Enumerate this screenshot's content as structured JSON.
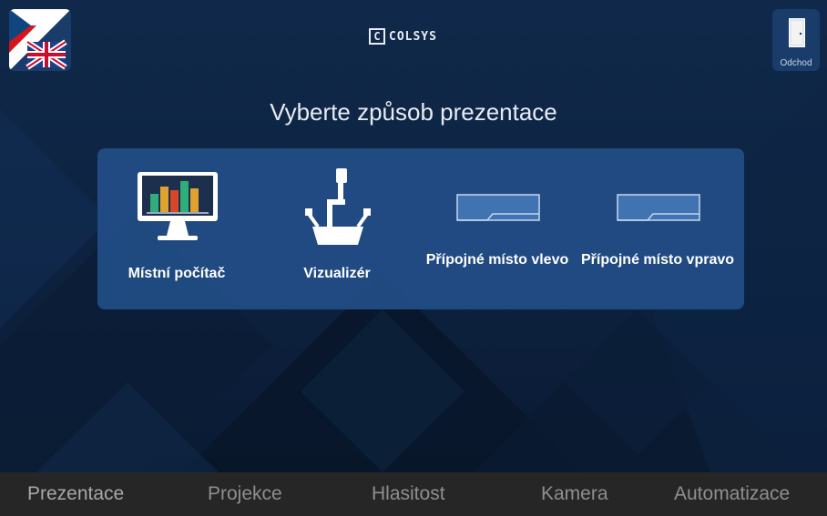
{
  "header": {
    "logo_text": "COLSYS",
    "logo_mark": "C",
    "exit_label": "Odchod"
  },
  "main": {
    "heading": "Vyberte způsob prezentace",
    "options": [
      {
        "label": "Místní počítač",
        "icon": "monitor-chart-icon"
      },
      {
        "label": "Vizualizér",
        "icon": "document-camera-icon"
      },
      {
        "label": "Přípojné místo vlevo",
        "icon": "wall-port-icon"
      },
      {
        "label": "Přípojné místo vpravo",
        "icon": "wall-port-icon"
      }
    ]
  },
  "tabs": [
    {
      "label": "Prezentace",
      "active": true
    },
    {
      "label": "Projekce",
      "active": false
    },
    {
      "label": "Hlasitost",
      "active": false
    },
    {
      "label": "Kamera",
      "active": false
    },
    {
      "label": "Automatizace",
      "active": false
    }
  ],
  "colors": {
    "background": "#0d2340",
    "panel": "#224e87",
    "tabbar": "#262626",
    "tab_text": "#8f8f8f"
  }
}
